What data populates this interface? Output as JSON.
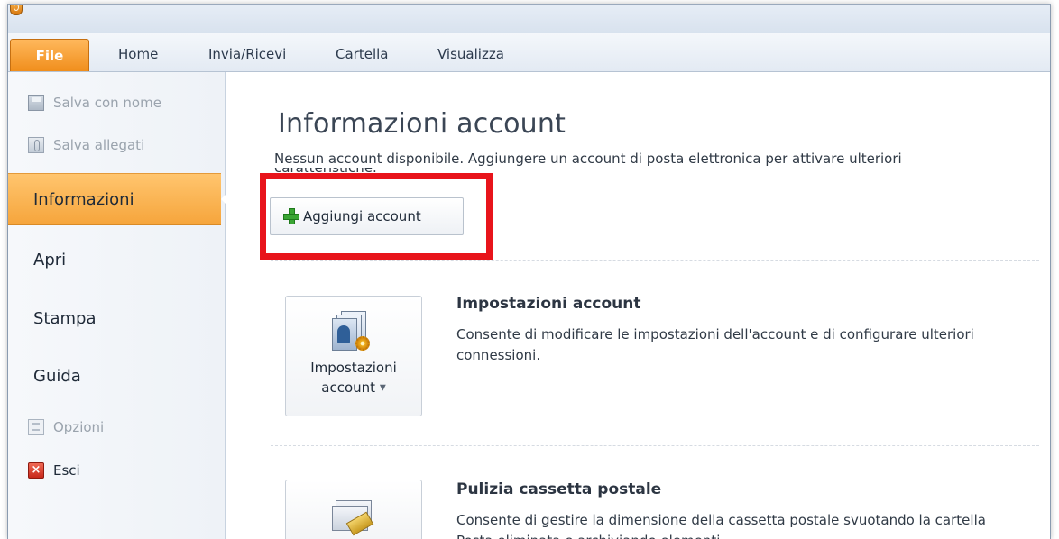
{
  "ribbon": {
    "tabs": [
      "File",
      "Home",
      "Invia/Ricevi",
      "Cartella",
      "Visualizza"
    ],
    "active_tab": "File"
  },
  "nav": {
    "commands_top": [
      {
        "label": "Salva con nome",
        "icon": "save-as-icon",
        "enabled": false
      },
      {
        "label": "Salva allegati",
        "icon": "save-attachments-icon",
        "enabled": false
      }
    ],
    "items": [
      "Informazioni",
      "Apri",
      "Stampa",
      "Guida"
    ],
    "selected": "Informazioni",
    "commands_bottom": [
      {
        "label": "Opzioni",
        "icon": "options-icon",
        "enabled": false
      },
      {
        "label": "Esci",
        "icon": "exit-icon",
        "enabled": true
      }
    ]
  },
  "main": {
    "title": "Informazioni account",
    "description": "Nessun account disponibile. Aggiungere un account di posta elettronica per attivare ulteriori",
    "description_cont": "caratteristiche.",
    "add_account_button": "Aggiungi account",
    "sections": [
      {
        "tile_label_1": "Impostazioni",
        "tile_label_2": "account",
        "tile_icon": "account-settings-icon",
        "title": "Impostazioni account",
        "description": "Consente di modificare le impostazioni dell'account e di configurare ulteriori connessioni."
      },
      {
        "tile_icon": "mailbox-cleanup-icon",
        "title": "Pulizia cassetta postale",
        "description": "Consente di gestire la dimensione della cassetta postale svuotando la cartella Posta eliminata e archiviando elementi."
      }
    ]
  },
  "colors": {
    "file_tab": "#f08e1c",
    "selected_nav": "#f6a53c",
    "highlight_box": "#e8141b"
  }
}
